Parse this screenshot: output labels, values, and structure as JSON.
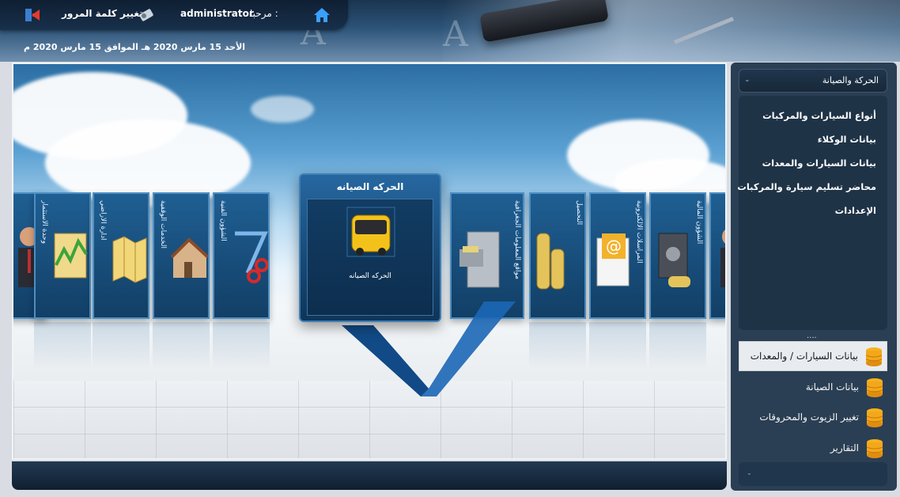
{
  "header": {
    "welcome_label": "مرحبا :",
    "username": "administrator",
    "change_password": "تغيير كلمة المرور",
    "date_line": "الأحد 15 مارس 2020 هـ  الموافق  15 مارس 2020 م",
    "watermark": "A"
  },
  "center": {
    "title": "الحركه الصيانه",
    "label": "الحركه الصيانه"
  },
  "carousel": {
    "left_cards": [
      "وحدة الاستثمار",
      "ادارة الأراضي",
      "الخدمات الوقفية",
      "الشؤون الفنية"
    ],
    "right_cards": [
      "مواقع المعلومات الجغرافية",
      "التحصيل",
      "المراسلات الالكترونية",
      "الشؤون المالية"
    ]
  },
  "sidebar": {
    "dropdown_label": "الحركة والصيانة",
    "links": [
      "أنواع السيارات والمركبات",
      "بيانات الوكلاء",
      "بيانات السيارات والمعدات",
      "محاضر تسليم سيارة والمركبات",
      "الإعدادات"
    ],
    "dots": "....",
    "accordion": [
      "بيانات السيارات / والمعدات",
      "بيانات الصيانة",
      "تغيير الزيوت والمحروقات",
      "التقارير"
    ]
  },
  "colors": {
    "accent": "#2667a0",
    "header_dark": "#0f1f33",
    "sidebar": "#2b3f54",
    "icon_gold": "#f3a71a"
  }
}
